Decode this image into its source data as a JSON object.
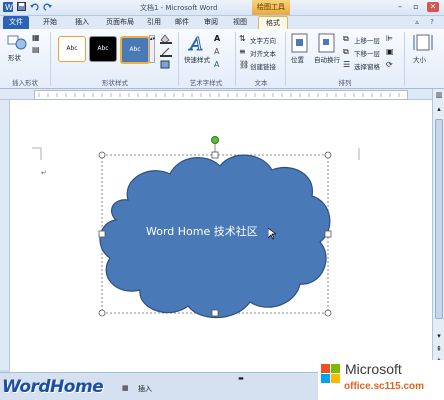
{
  "window": {
    "title": "文档1 - Microsoft Word",
    "context_group": "绘图工具",
    "qat_icons": [
      "word-icon",
      "save-icon",
      "undo-icon",
      "redo-icon"
    ],
    "buttons": [
      "minimize-icon",
      "restore-icon",
      "close-icon"
    ]
  },
  "tabs": [
    {
      "label": "文件"
    },
    {
      "label": "开始"
    },
    {
      "label": "插入"
    },
    {
      "label": "页面布局"
    },
    {
      "label": "引用"
    },
    {
      "label": "邮件"
    },
    {
      "label": "审阅"
    },
    {
      "label": "视图"
    },
    {
      "label": "格式"
    }
  ],
  "ribbon": {
    "insert_shapes": {
      "shape_btn": "形状",
      "label": "插入形状"
    },
    "shape_styles": {
      "styles": [
        "Abc",
        "Abc",
        "Abc"
      ],
      "label": "形状样式"
    },
    "wordart": {
      "quick_styles": "快速样式",
      "label": "艺术字样式"
    },
    "text": {
      "direction": "文字方向",
      "align": "对齐文本",
      "link": "创建链接",
      "label": "文本"
    },
    "arrange": {
      "position": "位置",
      "wrap": "自动换行",
      "forward": "上移一层",
      "backward": "下移一层",
      "pane": "选择窗格",
      "label": "排列"
    },
    "size": {
      "label": "大小"
    }
  },
  "document": {
    "shape_text": "Word Home 技术社区",
    "shape_type": "cloud",
    "fill_color": "#4a79b8",
    "stroke_color": "#2d4f82"
  },
  "statusbar": {
    "mode_label": "插入"
  },
  "watermark": {
    "left": "WordHome",
    "brand_name": "Microsoft",
    "site": "office.sc115.com"
  }
}
